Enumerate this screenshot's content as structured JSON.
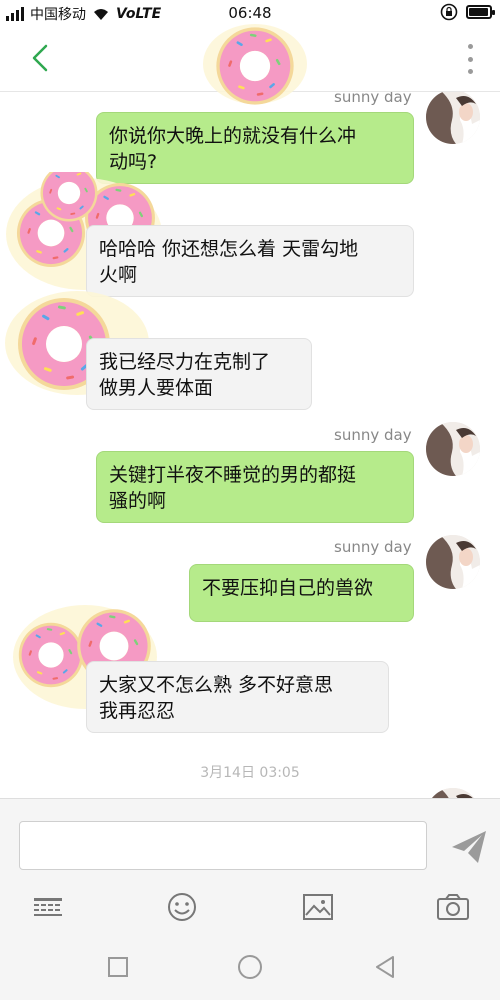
{
  "status_bar": {
    "carrier": "中国移动",
    "network": "VoLTE",
    "time": "06:48",
    "battery_level": 0.85
  },
  "header": {
    "back_icon": "chevron-left-icon",
    "more_icon": "more-vertical-icon"
  },
  "colors": {
    "accent": "#2fa84f",
    "sent_bubble": "#b6eb8b",
    "recv_bubble": "#f3f3f3"
  },
  "messages": [
    {
      "direction": "sent",
      "sender": "sunny day",
      "text_lines": [
        "你说你大晚上的就没有什么冲",
        "动吗?"
      ]
    },
    {
      "direction": "received",
      "text_lines": [
        "哈哈哈 你还想怎么着 天雷勾地",
        "火啊"
      ]
    },
    {
      "direction": "received",
      "text_lines": [
        "我已经尽力在克制了",
        "做男人要体面"
      ]
    },
    {
      "direction": "sent",
      "sender": "sunny day",
      "text_lines": [
        "关键打半夜不睡觉的男的都挺",
        "骚的啊"
      ]
    },
    {
      "direction": "sent",
      "sender": "sunny day",
      "text_lines": [
        "不要压抑自己的兽欲"
      ]
    },
    {
      "direction": "received",
      "text_lines": [
        "大家又不怎么熟 多不好意思",
        "我再忍忍"
      ]
    }
  ],
  "timestamp": "3月14日 03:05",
  "input": {
    "value": "",
    "send_icon": "send-icon"
  },
  "toolbar": [
    "keyboard-icon",
    "emoji-icon",
    "image-icon",
    "camera-icon"
  ],
  "nav": [
    "recent-apps-icon",
    "home-icon",
    "back-icon"
  ]
}
